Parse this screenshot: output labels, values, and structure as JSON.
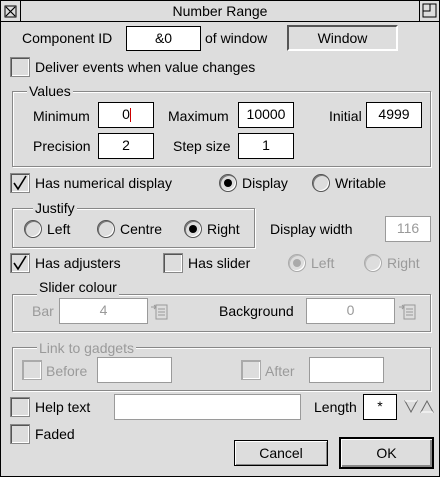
{
  "window": {
    "title": "Number Range"
  },
  "component": {
    "id_label": "Component ID",
    "id_value": "&0",
    "of_window_label": "of window",
    "window_value": "Window"
  },
  "deliver_events": {
    "label": "Deliver events when value changes",
    "checked": false
  },
  "values": {
    "group_label": "Values",
    "minimum_label": "Minimum",
    "minimum_value": "0",
    "maximum_label": "Maximum",
    "maximum_value": "10000",
    "initial_label": "Initial",
    "initial_value": "4999",
    "precision_label": "Precision",
    "precision_value": "2",
    "step_label": "Step size",
    "step_value": "1"
  },
  "numerical_display": {
    "label": "Has numerical display",
    "checked": true,
    "display_label": "Display",
    "display_selected": true,
    "writable_label": "Writable"
  },
  "justify": {
    "group_label": "Justify",
    "left_label": "Left",
    "centre_label": "Centre",
    "right_label": "Right",
    "selected": "Right",
    "display_width_label": "Display width",
    "display_width_value": "116"
  },
  "adjusters": {
    "label": "Has adjusters",
    "checked": true
  },
  "slider": {
    "label": "Has slider",
    "checked": false,
    "left_label": "Left",
    "right_label": "Right",
    "selected": "Left"
  },
  "slider_colour": {
    "group_label": "Slider colour",
    "bar_label": "Bar",
    "bar_value": "4",
    "background_label": "Background",
    "background_value": "0"
  },
  "link": {
    "group_label": "Link to gadgets",
    "before_label": "Before",
    "before_value": "",
    "after_label": "After",
    "after_value": ""
  },
  "help_text": {
    "label": "Help text",
    "value": "",
    "checked": false
  },
  "length": {
    "label": "Length",
    "value": "*"
  },
  "faded": {
    "label": "Faded",
    "checked": false
  },
  "buttons": {
    "cancel": "Cancel",
    "ok": "OK"
  },
  "colors": {
    "background": "#dddddd",
    "field": "#ffffff",
    "disabled_text": "#9a9a9a",
    "caret": "#cc0000"
  }
}
